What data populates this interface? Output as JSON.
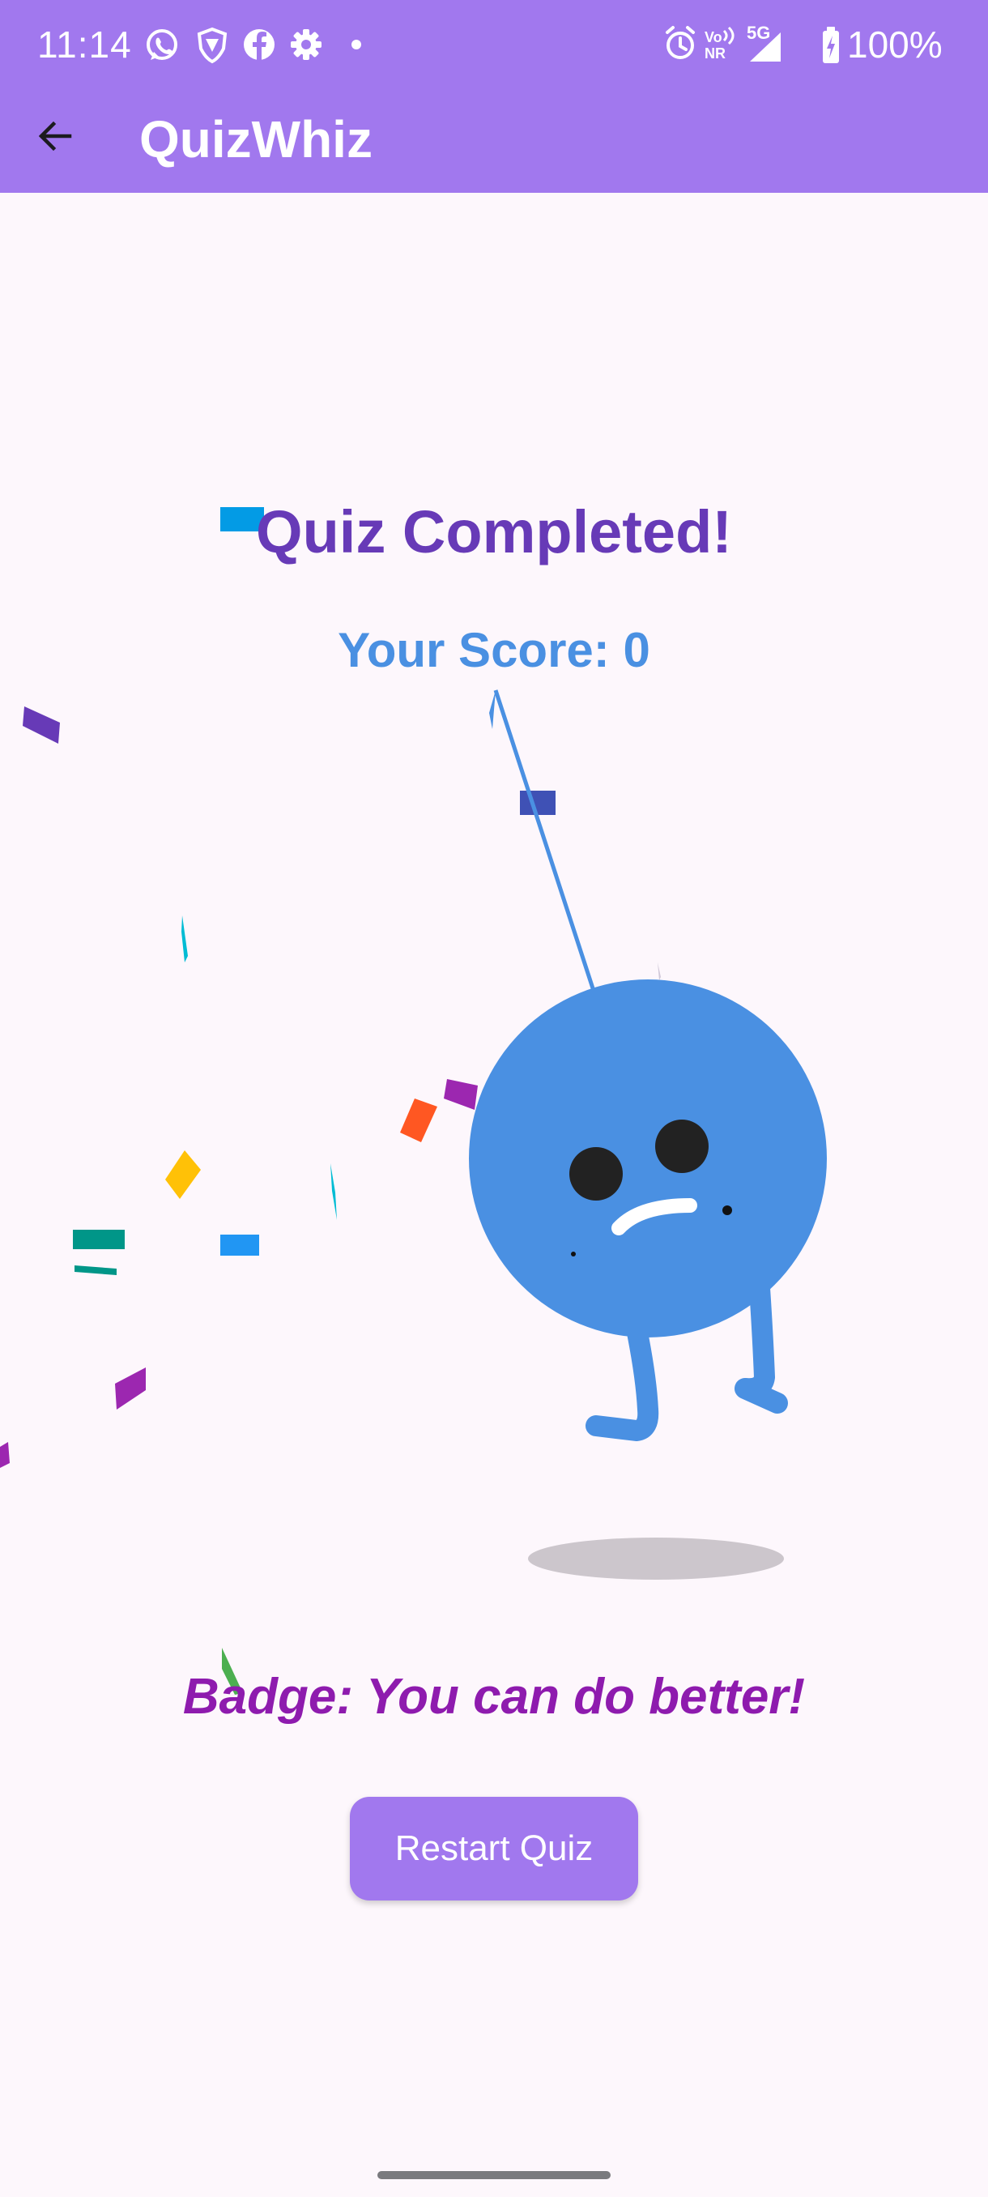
{
  "status_bar": {
    "time": "11:14",
    "battery": "100%",
    "left_icons": [
      "whatsapp-icon",
      "vpn-shield-icon",
      "facebook-icon",
      "settings-gear-icon",
      "dot-icon"
    ],
    "right_icons": [
      "alarm-icon",
      "volte-nr-icon",
      "5g-signal-icon",
      "battery-charging-icon"
    ],
    "network_label": "5G",
    "volte_label_top": "Vo",
    "volte_label_bottom": "NR"
  },
  "app_bar": {
    "title": "QuizWhiz",
    "back_icon": "arrow-back-icon"
  },
  "result": {
    "title": "Quiz Completed!",
    "score": "Your Score: 0",
    "badge": "Badge: You can do better!"
  },
  "actions": {
    "restart_label": "Restart Quiz"
  },
  "colors": {
    "primary": "#A178EE",
    "title_purple": "#673AB7",
    "score_blue": "#4A90E2",
    "badge_purple": "#8E1BAE",
    "background": "#FDF7FC",
    "character_blue": "#4A90E2"
  },
  "illustration": {
    "character": "sad-blue-ball-character",
    "effects": "confetti"
  }
}
